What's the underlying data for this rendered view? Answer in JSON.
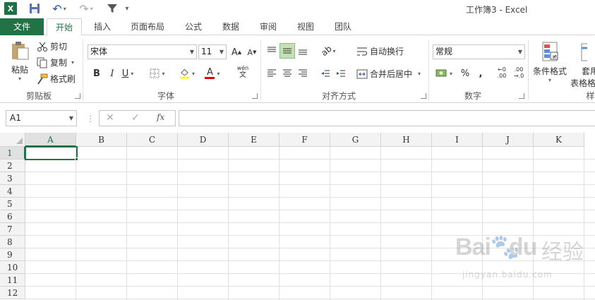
{
  "title_bar": {
    "app_logo_text": "X",
    "window_title": "工作簿3 - Excel"
  },
  "tabs": [
    {
      "label": "文件"
    },
    {
      "label": "开始"
    },
    {
      "label": "插入"
    },
    {
      "label": "页面布局"
    },
    {
      "label": "公式"
    },
    {
      "label": "数据"
    },
    {
      "label": "审阅"
    },
    {
      "label": "视图"
    },
    {
      "label": "团队"
    }
  ],
  "ribbon": {
    "clipboard": {
      "paste_label": "粘贴",
      "cut_label": "剪切",
      "copy_label": "复制",
      "format_painter_label": "格式刷",
      "group_label": "剪贴板"
    },
    "font": {
      "font_name": "宋体",
      "font_size": "11",
      "grow_label": "A",
      "shrink_label": "A",
      "bold_label": "B",
      "italic_label": "I",
      "underline_label": "U",
      "font_color_label": "A",
      "phonetic_label": "wén",
      "phonetic_sub": "文",
      "group_label": "字体"
    },
    "alignment": {
      "wrap_text_label": "自动换行",
      "merge_center_label": "合并后居中",
      "group_label": "对齐方式"
    },
    "number": {
      "format": "常规",
      "percent_label": "%",
      "comma_label": ",",
      "inc_decimal_top": "←0",
      "inc_decimal_bottom": ".00",
      "dec_decimal_top": ".00",
      "dec_decimal_bottom": "→.0",
      "group_label": "数字"
    },
    "styles": {
      "conditional_format_label": "条件格式",
      "table_format_label_1": "套用",
      "table_format_label_2": "表格格",
      "group_label_partial": "样"
    }
  },
  "formula_bar": {
    "name_box": "A1",
    "sep": "⋮",
    "cancel_symbol": "✕",
    "enter_symbol": "✓",
    "fx_label": "fx",
    "formula": ""
  },
  "sheet": {
    "columns": [
      "A",
      "B",
      "C",
      "D",
      "E",
      "F",
      "G",
      "H",
      "I",
      "J",
      "K"
    ],
    "rows": [
      "1",
      "2",
      "3",
      "4",
      "5",
      "6",
      "7",
      "8",
      "9",
      "10",
      "11",
      "12"
    ],
    "active_cell": "A1"
  },
  "watermark": {
    "brand": "Bai",
    "brand2": "du",
    "suffix": "经验",
    "url": "jingyan.baidu.com"
  },
  "colors": {
    "excel_green": "#217346",
    "grid_line": "#e1e1e1",
    "header_bg": "#f3f3f3"
  }
}
